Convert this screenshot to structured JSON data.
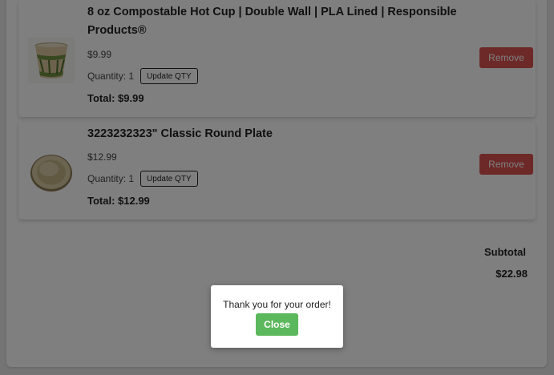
{
  "cart": {
    "items": [
      {
        "title": "8 oz Compostable Hot Cup | Double Wall | PLA Lined | Responsible Products®",
        "price": "$9.99",
        "quantity_label": "Quantity: 1",
        "update_label": "Update QTY",
        "total": "Total: $9.99",
        "remove_label": "Remove",
        "image_icon": "cup-image"
      },
      {
        "title": "3223232323\" Classic Round Plate",
        "price": "$12.99",
        "quantity_label": "Quantity: 1",
        "update_label": "Update QTY",
        "total": "Total: $12.99",
        "remove_label": "Remove",
        "image_icon": "plate-image"
      }
    ],
    "subtotal_label": "Subtotal",
    "subtotal_value": "$22.98"
  },
  "modal": {
    "message": "Thank you for your order!",
    "close_label": "Close"
  },
  "colors": {
    "remove": "#d9534f",
    "close": "#5cb85c",
    "overlay": "rgba(0,0,0,0.5)"
  }
}
